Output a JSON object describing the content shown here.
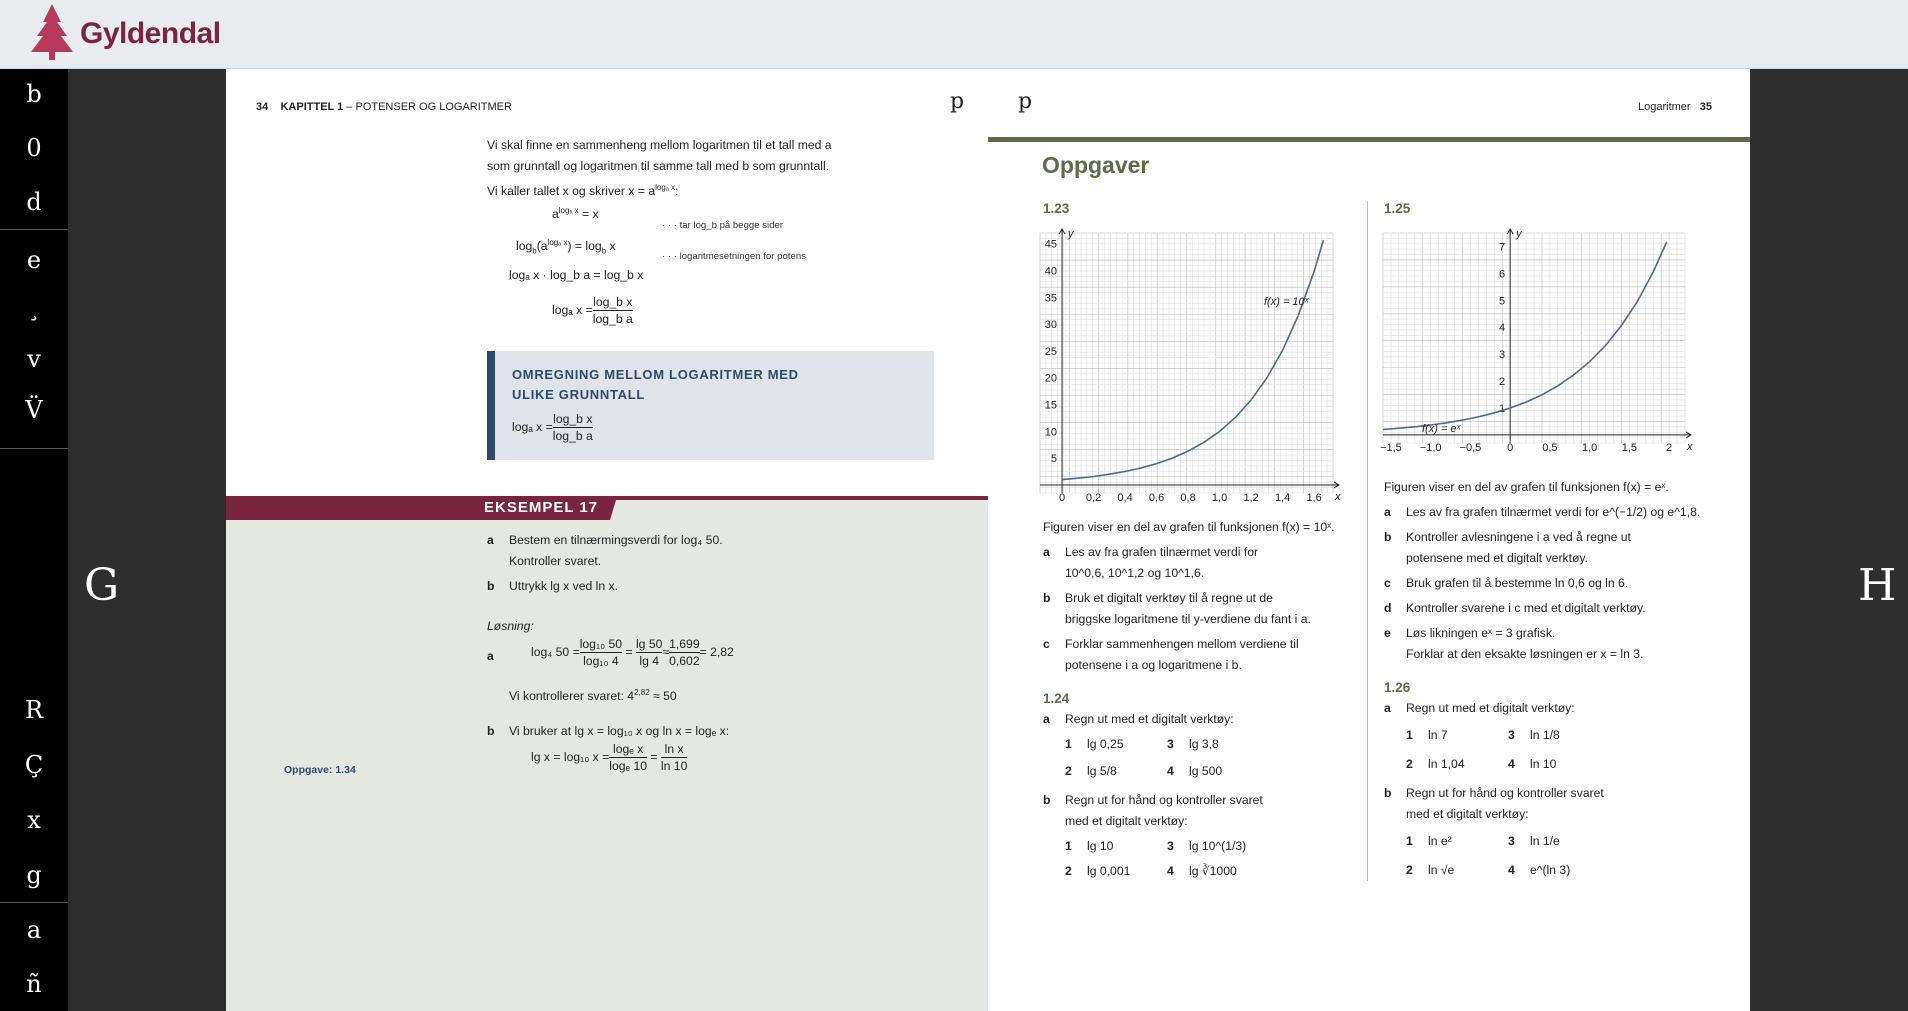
{
  "app": {
    "brand": "Gyldendal"
  },
  "sidebar": {
    "top": [
      "b",
      "0",
      "d",
      "e",
      "¸",
      "v",
      "V̈"
    ],
    "bottom": [
      "R",
      "Ç",
      "x",
      "g",
      "a",
      "ñ"
    ],
    "prev": "G",
    "next": "H"
  },
  "left_page": {
    "page_no": "34",
    "chapter": "KAPITTEL 1",
    "chapter_title": " – POTENSER OG LOGARITMER",
    "marker": "p",
    "intro": [
      "Vi skal finne en sammenheng mellom logaritmen til et tall med a",
      "som grunntall og logaritmen til samme tall med b som grunntall.",
      "Vi kaller tallet x og skriver x = a"
    ],
    "intro_sup": "logₐ x",
    "eq1": "a",
    "eq1_sup": "logₐ x",
    "eq1_rhs": " = x",
    "eq2": "log",
    "eq2_rhs": " = log",
    "note1": "· · · tar log_b på begge sider",
    "note2": "· · · logaritmesetningen for potens",
    "eq3": "logₐ x · log_b a = log_b x",
    "eq4_lhs": "logₐ x = ",
    "eq4_num": "log_b x",
    "eq4_den": "log_b a",
    "box_title_1": "OMREGNING MELLOM LOGARITMER MED",
    "box_title_2": "ULIKE GRUNNTALL",
    "box_lhs": "logₐ x = ",
    "box_num": "log_b x",
    "box_den": "log_b a",
    "example_title": "EKSEMPEL 17",
    "ex_a_label": "a",
    "ex_a_text": "Bestem en tilnærmingsverdi for log₄ 50.",
    "ex_a_text2": "Kontroller svaret.",
    "ex_b_label": "b",
    "ex_b_text": "Uttrykk  lg x  ved  ln x.",
    "losning": "Løsning:",
    "sol_a_label": "a",
    "sol_a_lhs": "log₄ 50 = ",
    "f1n": "log₁₀ 50",
    "f1d": "log₁₀ 4",
    "f2n": "lg 50",
    "f2d": "lg 4",
    "approx": " ≈ ",
    "f3n": "1,699",
    "f3d": "0,602",
    "sol_a_res": " = 2,82",
    "check": "Vi kontrollerer svaret:  4",
    "check_sup": "2,82",
    "check_rhs": " ≈ 50",
    "sol_b_label": "b",
    "sol_b_text": "Vi bruker at  lg x = log₁₀ x  og  ln x = logₑ x:",
    "sol_b_lhs": "lg x = log₁₀ x = ",
    "f4n": "logₑ x",
    "f4d": "logₑ 10",
    "f5n": "ln x",
    "f5d": "ln 10",
    "oppgave": "Oppgave: 1.34"
  },
  "right_page": {
    "marker": "p",
    "section": "Logaritmer",
    "page_no": "35",
    "heading": "Oppgaver",
    "t123": {
      "num": "1.23",
      "desc": "Figuren viser en del av grafen til funksjonen f(x) = 10ˣ.",
      "a": "a",
      "a1": "Les av fra grafen tilnærmet verdi for",
      "a2": "10^0,6, 10^1,2 og 10^1,6.",
      "b": "b",
      "b1": "Bruk et digitalt verktøy til å regne ut de",
      "b2": "briggske logaritmene til y-verdiene du fant i a.",
      "c": "c",
      "c1": "Forklar sammenhengen mellom verdiene til",
      "c2": "potensene i a og logaritmene i b."
    },
    "t124": {
      "num": "1.24",
      "a": "a",
      "a_text": "Regn ut med et digitalt verktøy:",
      "a_items": [
        "1",
        "lg 0,25",
        "3",
        "lg 3,8",
        "2",
        "lg 5/8",
        "4",
        "lg 500"
      ],
      "b": "b",
      "b1": "Regn ut for hånd og kontroller svaret",
      "b2": "med et digitalt verktøy:",
      "b_items": [
        "1",
        "lg 10",
        "3",
        "lg 10^(1/3)",
        "2",
        "lg 0,001",
        "4",
        "lg ∛1000"
      ]
    },
    "t125": {
      "num": "1.25",
      "desc": "Figuren viser en del av grafen til funksjonen f(x) = eˣ.",
      "a": "a",
      "a_text": "Les av fra grafen tilnærmet verdi for e^(−1/2) og e^1,8.",
      "b": "b",
      "b1": "Kontroller avlesningene i a ved å regne ut",
      "b2": "potensene med et digitalt verktøy.",
      "c": "c",
      "c_text": "Bruk grafen til å bestemme ln 0,6 og ln 6.",
      "d": "d",
      "d_text": "Kontroller svarene i c med et digitalt verktøy.",
      "e": "e",
      "e1": "Løs likningen eˣ = 3 grafisk.",
      "e2": "Forklar at den eksakte løsningen er x = ln 3."
    },
    "t126": {
      "num": "1.26",
      "a": "a",
      "a_text": "Regn ut med et digitalt verktøy:",
      "a_items": [
        "1",
        "ln 7",
        "3",
        "ln 1/8",
        "2",
        "ln 1,04",
        "4",
        "ln 10"
      ],
      "b": "b",
      "b1": "Regn ut for hånd og kontroller svaret",
      "b2": "med et digitalt verktøy:",
      "b_items": [
        "1",
        "ln e²",
        "3",
        "ln 1/e",
        "2",
        "ln √e",
        "4",
        "e^(ln 3)"
      ]
    }
  },
  "chart_data": [
    {
      "type": "line",
      "title": "",
      "xlabel": "x",
      "ylabel": "y",
      "annotation": "f(x) = 10ˣ",
      "x": [
        0,
        0.1,
        0.2,
        0.3,
        0.4,
        0.5,
        0.6,
        0.7,
        0.8,
        0.9,
        1.0,
        1.1,
        1.2,
        1.3,
        1.4,
        1.5,
        1.6,
        1.66
      ],
      "y": [
        1,
        1.26,
        1.58,
        2,
        2.51,
        3.16,
        3.98,
        5.01,
        6.31,
        7.94,
        10,
        12.59,
        15.85,
        19.95,
        25.12,
        31.62,
        39.81,
        45.7
      ],
      "xlim": [
        -0.14,
        1.72
      ],
      "ylim": [
        -1.5,
        47
      ],
      "xticks": [
        "0",
        "0,2",
        "0,4",
        "0,6",
        "0,8",
        "1,0",
        "1,2",
        "1,4",
        "1,6"
      ],
      "yticks": [
        "5",
        "10",
        "15",
        "20",
        "25",
        "30",
        "35",
        "40",
        "45"
      ],
      "grid": true,
      "color": "#4a6a8f"
    },
    {
      "type": "line",
      "title": "",
      "xlabel": "x",
      "ylabel": "y",
      "annotation": "f(x) = eˣ",
      "x": [
        -1.6,
        -1.4,
        -1.2,
        -1.0,
        -0.8,
        -0.6,
        -0.4,
        -0.2,
        0,
        0.2,
        0.4,
        0.6,
        0.8,
        1.0,
        1.2,
        1.4,
        1.6,
        1.8,
        1.97
      ],
      "y": [
        0.2,
        0.25,
        0.3,
        0.37,
        0.45,
        0.55,
        0.67,
        0.82,
        1,
        1.22,
        1.49,
        1.82,
        2.23,
        2.72,
        3.32,
        4.06,
        4.95,
        6.05,
        7.17
      ],
      "xlim": [
        -1.6,
        2.2
      ],
      "ylim": [
        -0.3,
        7.5
      ],
      "xticks": [
        "−1,5",
        "−1,0",
        "−0,5",
        "0",
        "0,5",
        "1,0",
        "1,5",
        "2"
      ],
      "yticks": [
        "1",
        "2",
        "3",
        "4",
        "5",
        "6",
        "7"
      ],
      "grid": true,
      "color": "#4a6a8f"
    }
  ]
}
